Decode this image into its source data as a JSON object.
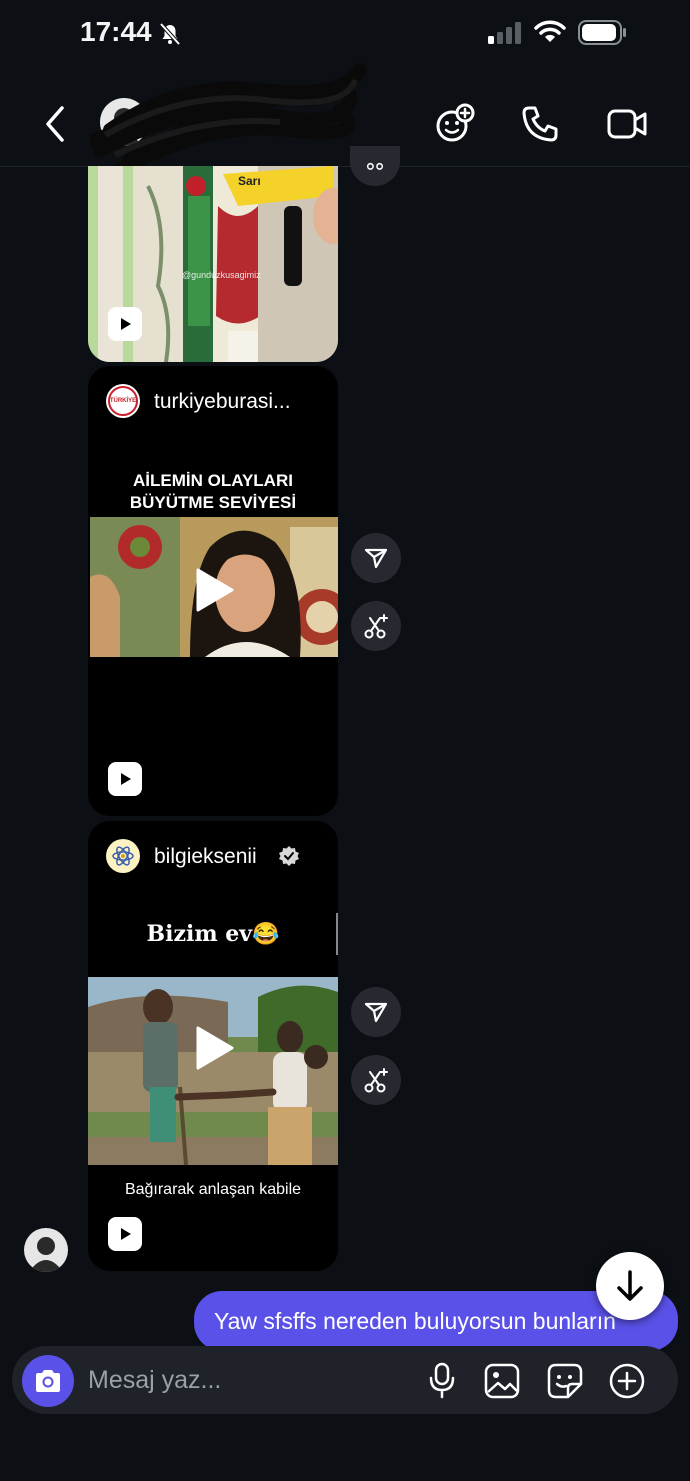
{
  "status_bar": {
    "time": "17:44",
    "icons": [
      "bell-slash-icon",
      "signal-icon",
      "wifi-icon",
      "battery-icon"
    ]
  },
  "header": {
    "back": "chevron-left-icon",
    "actions": [
      "effects-icon",
      "phone-icon",
      "video-icon"
    ]
  },
  "messages": [
    {
      "type": "reel",
      "watermark": "@gunduzkusagimiz",
      "sign_text": "Sarı"
    },
    {
      "type": "reel",
      "account": "turkiyeburasi...",
      "logo_text": "TÜRKİYE",
      "title_line1": "AİLEMİN OLAYLARI",
      "title_line2": "BÜYÜTME SEVİYESİ"
    },
    {
      "type": "reel",
      "account": "bilgieksenii",
      "verified": true,
      "title": "Bizim ev😂",
      "caption": "Bağırarak anlaşan kabile"
    }
  ],
  "outgoing": {
    "text": "Yaw sfsffs nereden buluyorsun bunların"
  },
  "composer": {
    "placeholder": "Mesaj yaz...",
    "icons": [
      "camera-icon",
      "microphone-icon",
      "gallery-icon",
      "sticker-icon",
      "plus-icon"
    ]
  },
  "colors": {
    "background": "#0c1014",
    "accent": "#5a51e8",
    "card": "#000000",
    "round_button": "#262a30"
  }
}
